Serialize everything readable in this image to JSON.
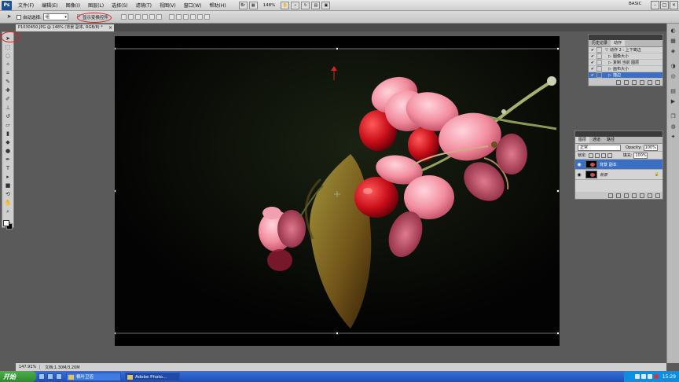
{
  "menubar": {
    "logo": "Ps",
    "items": [
      "文件(F)",
      "编辑(E)",
      "图像(I)",
      "图层(L)",
      "选择(S)",
      "滤镜(T)",
      "视图(V)",
      "窗口(W)",
      "帮助(H)"
    ],
    "zoom": "148%",
    "workspace": "BASIC"
  },
  "options": {
    "auto_select_label": "自动选择:",
    "auto_select_value": "组",
    "show_transform_label": "显示变换控件",
    "show_transform_checked": "☑"
  },
  "document": {
    "tab_title": "P1030450.JPG @ 148% (背景 副本, RGB/8) *"
  },
  "status": {
    "zoom": "147.91%",
    "doc": "文档:1.30M/3.20M"
  },
  "actions_panel": {
    "tabs": [
      "历史记录",
      "动作"
    ],
    "rows": [
      {
        "check": "✔",
        "tri": "▽",
        "label": "动作 2 : 上下离边",
        "selected": false
      },
      {
        "check": "✔",
        "tri": "▷",
        "label": "图像大小",
        "selected": false
      },
      {
        "check": "✔",
        "tri": "▷",
        "label": "复制 当前 图层",
        "selected": false
      },
      {
        "check": "✔",
        "tri": "▷",
        "label": "画布大小",
        "selected": false
      },
      {
        "check": "✔",
        "tri": "▷",
        "label": "描边",
        "selected": true
      }
    ]
  },
  "layers_panel": {
    "tabs": [
      "图层",
      "通道",
      "路径"
    ],
    "blend_mode": "正常",
    "opacity_label": "Opacity:",
    "opacity": "100%",
    "lock_label": "锁定:",
    "fill_label": "填充:",
    "fill": "100%",
    "layers": [
      {
        "name": "背景 副本",
        "selected": true,
        "lock": ""
      },
      {
        "name": "背景",
        "selected": false,
        "lock": "🔒"
      }
    ]
  },
  "taskbar": {
    "start_label": "开始",
    "tasks": [
      "枫叶卫浴",
      "Adobe Photo..."
    ],
    "time": "15:29"
  },
  "colors": {
    "accent": "#3a6fc4",
    "annotation": "#e02020"
  }
}
